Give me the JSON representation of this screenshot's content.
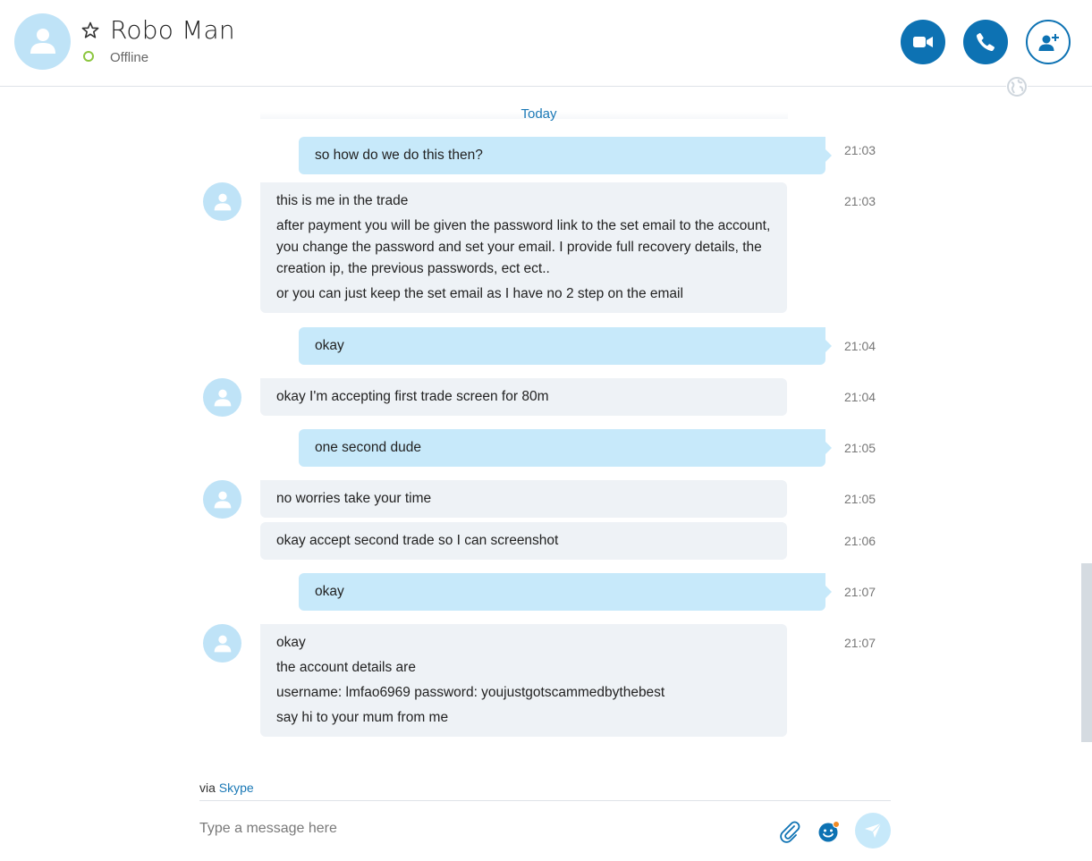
{
  "header": {
    "contact_name": "Robo Man",
    "status": "Offline",
    "icons": {
      "avatar": "person-icon",
      "favorite": "star-icon",
      "video": "video-camera-icon",
      "call": "phone-icon",
      "add": "add-person-icon"
    }
  },
  "colors": {
    "accent": "#0d72b3",
    "outgoing_bubble": "#c7e9fa",
    "incoming_bubble": "#eef2f6",
    "online_ring": "#8cc63f",
    "link": "#1a78b6"
  },
  "chat": {
    "date_divider": "Today",
    "messages": [
      {
        "direction": "out",
        "time": "21:03",
        "lines": [
          "so how do we do this then?"
        ]
      },
      {
        "direction": "in",
        "time": "21:03",
        "lines": [
          "this is me in the trade",
          "after payment you will be given the password link to the set email to the account, you change the password and set your email.  I provide full recovery details, the creation ip, the previous passwords, ect ect..",
          "or you can just keep the set email as I have no 2 step on the email"
        ]
      },
      {
        "direction": "out",
        "time": "21:04",
        "lines": [
          "okay"
        ]
      },
      {
        "direction": "in",
        "time": "21:04",
        "lines": [
          "okay I'm accepting first trade screen for 80m"
        ]
      },
      {
        "direction": "out",
        "time": "21:05",
        "lines": [
          "one second dude"
        ]
      },
      {
        "direction": "in",
        "time": "21:05",
        "lines": [
          "no worries take your time"
        ]
      },
      {
        "direction": "in",
        "time": "21:06",
        "lines": [
          "okay accept second trade so I can screenshot"
        ]
      },
      {
        "direction": "out",
        "time": "21:07",
        "lines": [
          "okay"
        ]
      },
      {
        "direction": "in",
        "time": "21:07",
        "lines": [
          "okay",
          "the account details are",
          "username: lmfao6969  password: youjustgotscammedbythebest",
          "say hi to your mum from me"
        ]
      }
    ]
  },
  "composer": {
    "via_prefix": "via",
    "via_link": "Skype",
    "placeholder": "Type a message here",
    "icons": {
      "attach": "paperclip-icon",
      "emoji": "emoticon-icon",
      "send": "send-icon"
    }
  }
}
